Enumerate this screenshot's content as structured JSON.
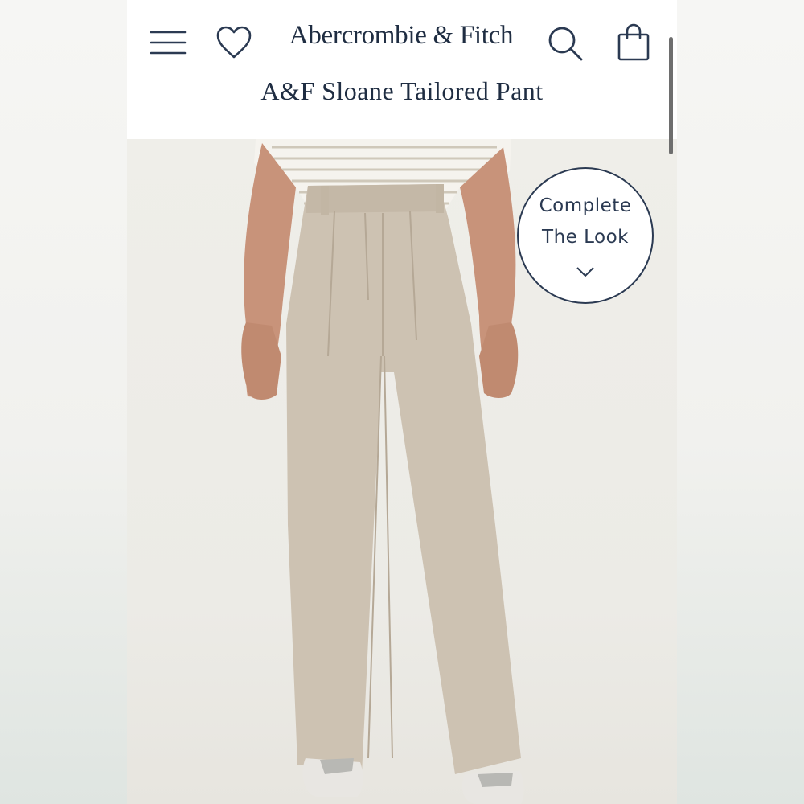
{
  "header": {
    "brand": "Abercrombie & Fitch",
    "product_title": "A&F Sloane Tailored Pant",
    "icons": [
      "menu-icon",
      "heart-icon",
      "search-icon",
      "shopping-bag-icon"
    ]
  },
  "complete_look": {
    "line1": "Complete",
    "line2": "The Look",
    "icon": "chevron-down-icon"
  },
  "colors": {
    "navy": "#1f2d42",
    "pant_taupe": "#cdc2b2",
    "header_bg": "#ffffff"
  }
}
